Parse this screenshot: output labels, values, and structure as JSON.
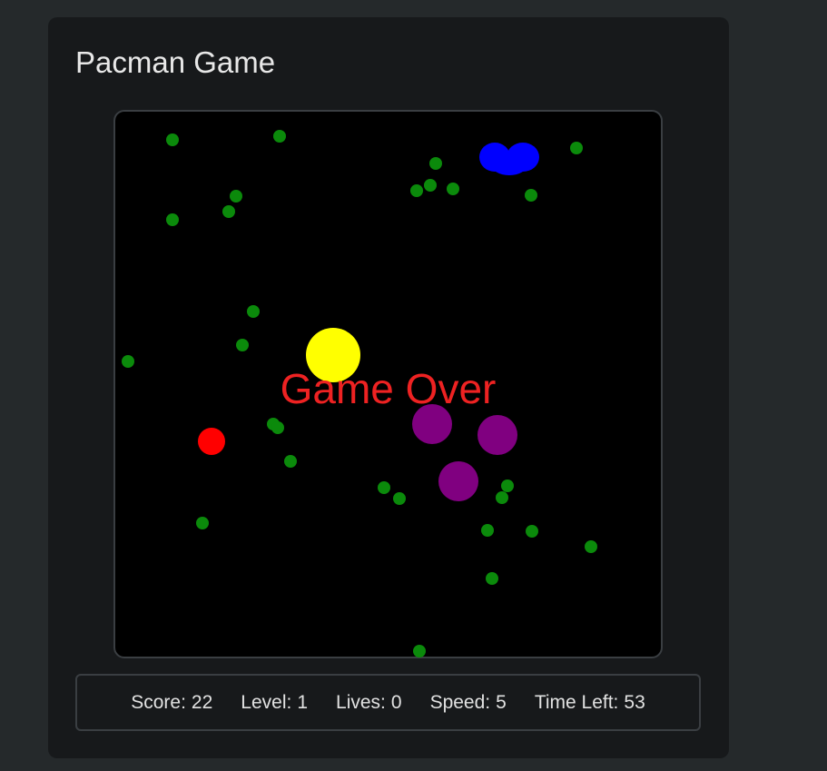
{
  "app": {
    "title": "Pacman Game"
  },
  "game": {
    "status_text": "Game Over",
    "colors": {
      "pellet": "#0b8a0b",
      "pacman": "#ffff00",
      "blue_ghost": "#0000ff",
      "red_ghost": "#ff0000",
      "purple_ghost": "#800080",
      "game_over_text": "#ee2222"
    }
  },
  "stats": {
    "score_label": "Score:",
    "score_value": "22",
    "level_label": "Level:",
    "level_value": "1",
    "lives_label": "Lives:",
    "lives_value": "0",
    "speed_label": "Speed:",
    "speed_value": "5",
    "time_left_label": "Time Left:",
    "time_left_value": "53"
  }
}
